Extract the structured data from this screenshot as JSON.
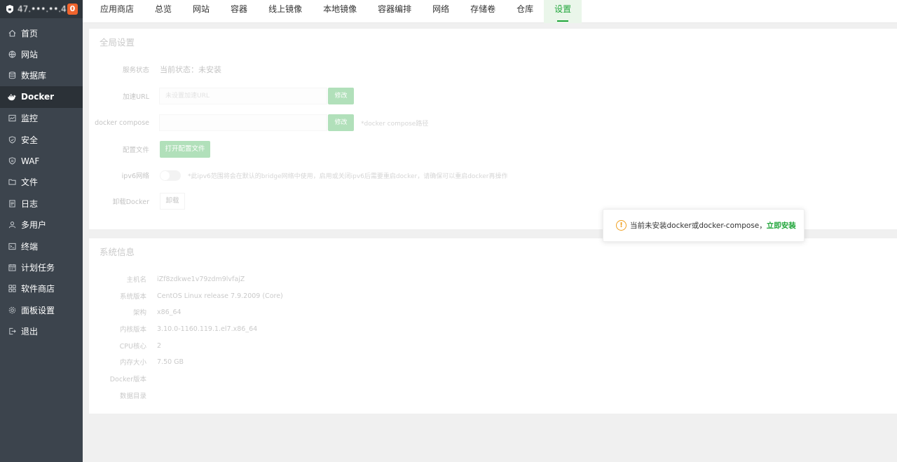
{
  "sidebar": {
    "host": "47.•••.••.4",
    "badge": "0",
    "items": [
      {
        "label": "首页",
        "icon": "home-icon"
      },
      {
        "label": "网站",
        "icon": "globe-icon"
      },
      {
        "label": "数据库",
        "icon": "database-icon"
      },
      {
        "label": "Docker",
        "icon": "docker-icon"
      },
      {
        "label": "监控",
        "icon": "monitor-icon"
      },
      {
        "label": "安全",
        "icon": "shield-icon"
      },
      {
        "label": "WAF",
        "icon": "waf-shield-icon"
      },
      {
        "label": "文件",
        "icon": "folder-icon"
      },
      {
        "label": "日志",
        "icon": "log-icon"
      },
      {
        "label": "多用户",
        "icon": "users-icon"
      },
      {
        "label": "终端",
        "icon": "terminal-icon"
      },
      {
        "label": "计划任务",
        "icon": "calendar-icon"
      },
      {
        "label": "软件商店",
        "icon": "grid-icon"
      },
      {
        "label": "面板设置",
        "icon": "gear-icon"
      },
      {
        "label": "退出",
        "icon": "logout-icon"
      }
    ]
  },
  "tabs": [
    "应用商店",
    "总览",
    "网站",
    "容器",
    "线上镜像",
    "本地镜像",
    "容器编排",
    "网络",
    "存储卷",
    "仓库",
    "设置"
  ],
  "global": {
    "title": "全局设置",
    "service_label": "服务状态",
    "service_value": "当前状态：未安装",
    "url_label": "加速URL",
    "url_placeholder": "未设置加速URL",
    "modify": "修改",
    "compose_label": "docker compose",
    "compose_hint": "*docker compose路径",
    "config_label": "配置文件",
    "config_button": "打开配置文件",
    "ipv6_label": "ipv6网络",
    "ipv6_hint": "*此ipv6范围将会在默认的bridge网络中使用，启用或关闭ipv6后需要重启docker，请确保可以重启docker再操作",
    "uninstall_label": "卸载Docker",
    "uninstall_button": "卸载"
  },
  "system": {
    "title": "系统信息",
    "rows": [
      {
        "label": "主机名",
        "value": "iZf8zdkwe1v79zdm9lvfajZ"
      },
      {
        "label": "系统版本",
        "value": "CentOS Linux release 7.9.2009 (Core)"
      },
      {
        "label": "架构",
        "value": "x86_64"
      },
      {
        "label": "内核版本",
        "value": "3.10.0-1160.119.1.el7.x86_64"
      },
      {
        "label": "CPU核心",
        "value": "2"
      },
      {
        "label": "内存大小",
        "value": "7.50 GB"
      },
      {
        "label": "Docker版本",
        "value": ""
      },
      {
        "label": "数据目录",
        "value": ""
      }
    ]
  },
  "toast": {
    "message": "当前未安装docker或docker-compose，",
    "link": "立即安装"
  }
}
